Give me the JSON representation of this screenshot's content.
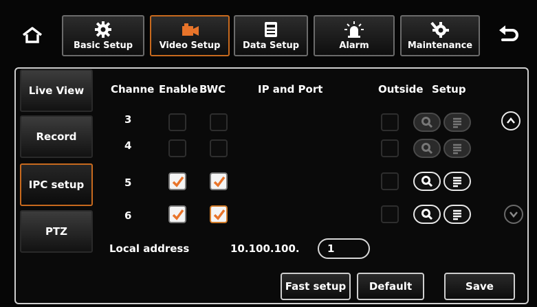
{
  "nav": {
    "home_icon": "home-icon",
    "back_icon": "back-arrow-icon",
    "tabs": [
      {
        "label": "Basic Setup",
        "icon": "gear-icon",
        "active": false
      },
      {
        "label": "Video Setup",
        "icon": "camera-icon",
        "active": true
      },
      {
        "label": "Data Setup",
        "icon": "storage-icon",
        "active": false
      },
      {
        "label": "Alarm",
        "icon": "alarm-light-icon",
        "active": false
      },
      {
        "label": "Maintenance",
        "icon": "wrench-gear-icon",
        "active": false
      }
    ]
  },
  "sidebar": {
    "items": [
      {
        "label": "Live View",
        "active": false
      },
      {
        "label": "Record",
        "active": false
      },
      {
        "label": "IPC setup",
        "active": true
      },
      {
        "label": "PTZ",
        "active": false
      }
    ]
  },
  "table": {
    "headers": {
      "channel": "Channe",
      "enable": "Enable",
      "bwc": "BWC",
      "ip_port": "IP and Port",
      "outside": "Outside",
      "setup": "Setup"
    },
    "rows": [
      {
        "channel": "3",
        "enable": false,
        "bwc": false,
        "outside": false,
        "buttons_active": false
      },
      {
        "channel": "4",
        "enable": false,
        "bwc": false,
        "outside": false,
        "buttons_active": false
      },
      {
        "channel": "5",
        "enable": true,
        "bwc": true,
        "outside": false,
        "buttons_active": true
      },
      {
        "channel": "6",
        "enable": true,
        "bwc": true,
        "outside": false,
        "buttons_active": true
      }
    ]
  },
  "local_address": {
    "label": "Local address",
    "prefix": "10.100.100.",
    "value": "1"
  },
  "buttons": {
    "fast_setup": "Fast setup",
    "default": "Default",
    "save": "Save"
  },
  "colors": {
    "accent": "#c86a1e",
    "check": "#e8742a"
  }
}
